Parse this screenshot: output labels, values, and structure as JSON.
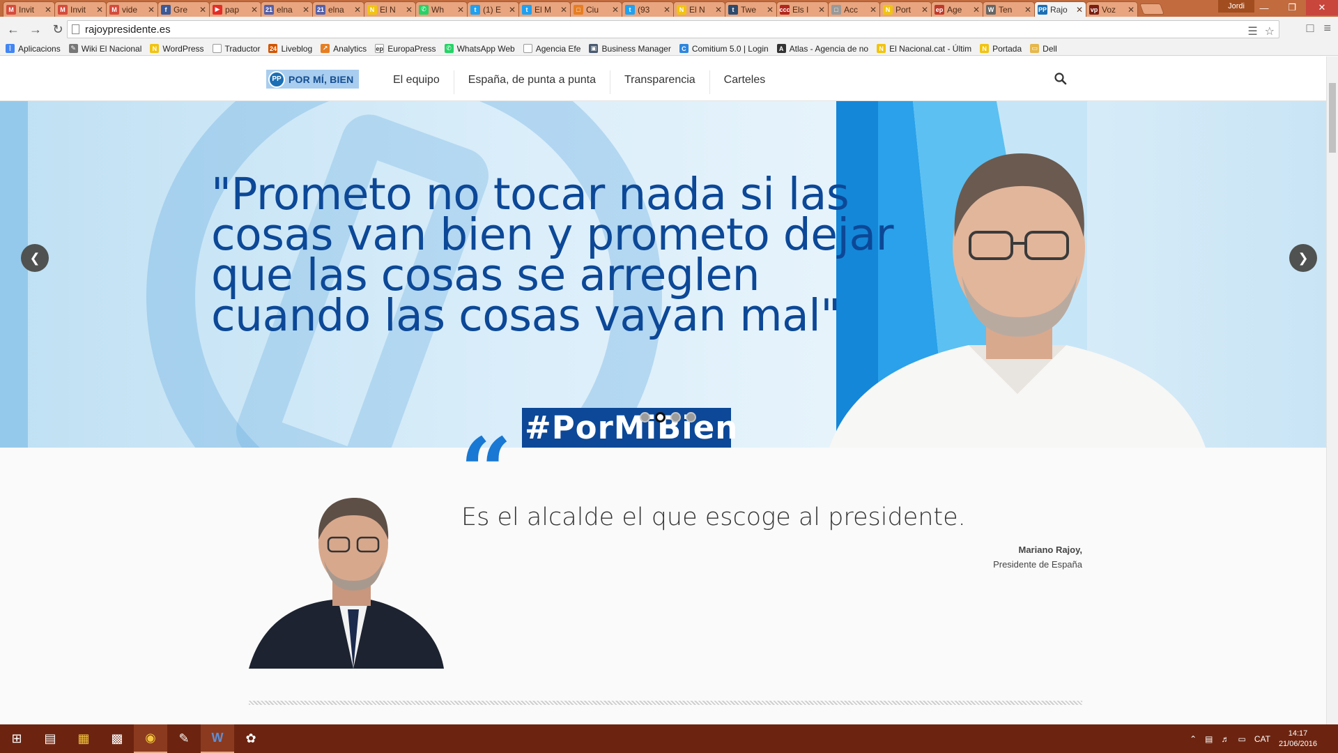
{
  "browser": {
    "tabs": [
      {
        "title": "Invit",
        "color": "#d54b3d",
        "glyph": "M"
      },
      {
        "title": "Invit",
        "color": "#d54b3d",
        "glyph": "M"
      },
      {
        "title": "vide",
        "color": "#d54b3d",
        "glyph": "M"
      },
      {
        "title": "Gre",
        "color": "#3b5998",
        "glyph": "f"
      },
      {
        "title": "pap",
        "color": "#e52d27",
        "glyph": "▶"
      },
      {
        "title": "elna",
        "color": "#5560a8",
        "glyph": "21"
      },
      {
        "title": "elna",
        "color": "#5560a8",
        "glyph": "21"
      },
      {
        "title": "El N",
        "color": "#f1c40f",
        "glyph": "N"
      },
      {
        "title": "Wh",
        "color": "#25d366",
        "glyph": "✆"
      },
      {
        "title": "(1) E",
        "color": "#1da1f2",
        "glyph": "t"
      },
      {
        "title": "El M",
        "color": "#1da1f2",
        "glyph": "t"
      },
      {
        "title": "Ciu",
        "color": "#e67e22",
        "glyph": "□"
      },
      {
        "title": "(93",
        "color": "#1da1f2",
        "glyph": "t"
      },
      {
        "title": "El N",
        "color": "#f1c40f",
        "glyph": "N"
      },
      {
        "title": "Twe",
        "color": "#2c4a6d",
        "glyph": "t"
      },
      {
        "title": "Els I",
        "color": "#b3261e",
        "glyph": "ccc"
      },
      {
        "title": "Acc",
        "color": "#999999",
        "glyph": "□"
      },
      {
        "title": "Port",
        "color": "#f1c40f",
        "glyph": "N"
      },
      {
        "title": "Age",
        "color": "#c0392b",
        "glyph": "ep"
      },
      {
        "title": "Ten",
        "color": "#666666",
        "glyph": "W"
      },
      {
        "title": "Rajo",
        "color": "#1b6fb5",
        "glyph": "PP",
        "active": true
      },
      {
        "title": "Voz",
        "color": "#7a1e12",
        "glyph": "vp"
      }
    ],
    "profile_name": "Jordi",
    "url": "rajoypresidente.es",
    "bookmarks": [
      {
        "label": "Aplicacions",
        "color": "#4285f4",
        "glyph": "⋮"
      },
      {
        "label": "Wiki El Nacional",
        "color": "#777777",
        "glyph": "✎"
      },
      {
        "label": "WordPress",
        "color": "#f1c40f",
        "glyph": "N"
      },
      {
        "label": "Traductor",
        "color": "#ffffff",
        "glyph": ""
      },
      {
        "label": "Liveblog",
        "color": "#d35400",
        "glyph": "24"
      },
      {
        "label": "Analytics",
        "color": "#e67e22",
        "glyph": "↗"
      },
      {
        "label": "EuropaPress",
        "color": "#ffffff",
        "glyph": "ep"
      },
      {
        "label": "WhatsApp Web",
        "color": "#25d366",
        "glyph": "✆"
      },
      {
        "label": "Agencia Efe",
        "color": "#ffffff",
        "glyph": ""
      },
      {
        "label": "Business Manager",
        "color": "#4a5a70",
        "glyph": "▣"
      },
      {
        "label": "Comitium 5.0 | Login",
        "color": "#2e86de",
        "glyph": "C"
      },
      {
        "label": "Atlas - Agencia de no",
        "color": "#333333",
        "glyph": "A"
      },
      {
        "label": "El Nacional.cat - Últim",
        "color": "#f1c40f",
        "glyph": "N"
      },
      {
        "label": "Portada",
        "color": "#f1c40f",
        "glyph": "N"
      },
      {
        "label": "Dell",
        "color": "#e6b84b",
        "glyph": "▭"
      }
    ]
  },
  "site": {
    "logo_text": "POR MÍ, BIEN",
    "logo_badge": "PP",
    "menu": [
      "El equipo",
      "España, de punta a punta",
      "Transparencia",
      "Carteles"
    ],
    "hero": {
      "quote": "\"Prometo no tocar nada si las cosas van bien y prometo dejar que las cosas se arreglen cuando las cosas vayan mal\"",
      "hashtag": "#PorMiBien",
      "slide_count": 4,
      "active_slide": 2
    },
    "quote_section": {
      "quote_mark": "“",
      "text": "Es el alcalde el que escoge al presidente.",
      "author_name": "Mariano Rajoy,",
      "author_title": "Presidente de España"
    }
  },
  "taskbar": {
    "language": "CAT",
    "time": "14:17",
    "date": "21/06/2016"
  }
}
